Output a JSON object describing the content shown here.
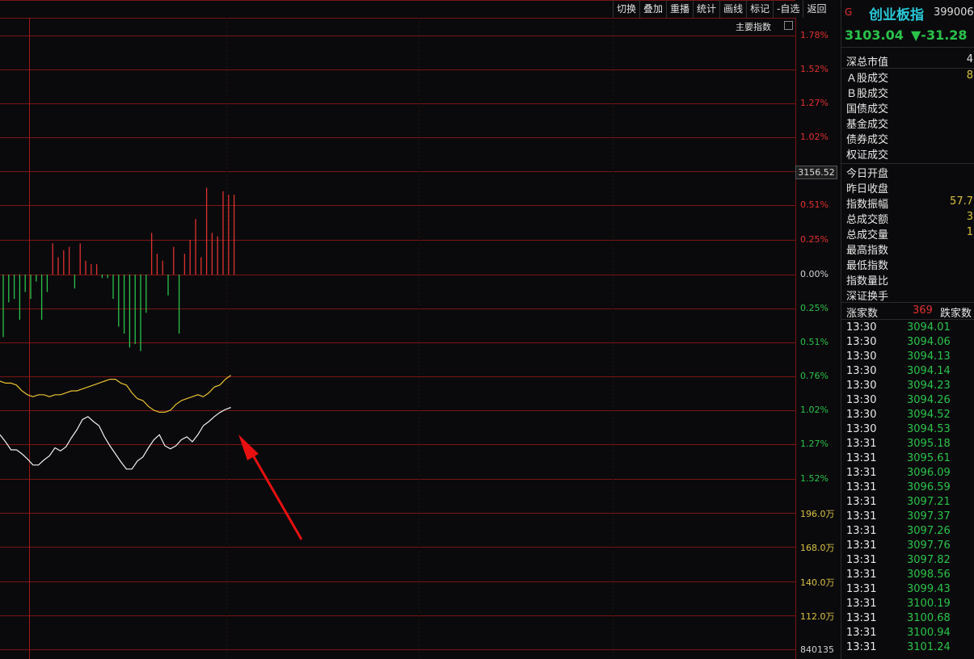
{
  "toolbar": {
    "buttons": [
      "切换",
      "叠加",
      "重播",
      "统计",
      "画线",
      "标记",
      "-自选",
      "返回"
    ]
  },
  "main_index_label": "主要指数",
  "price_tag": "3156.52",
  "right_axis": {
    "upper": [
      "1.78%",
      "1.52%",
      "1.27%",
      "1.02%",
      "0.51%",
      "0.25%",
      "0.00%",
      "0.25%",
      "0.51%",
      "0.76%",
      "1.02%",
      "1.27%",
      "1.52%"
    ],
    "volume": [
      "196.0万",
      "168.0万",
      "140.0万",
      "112.0万"
    ],
    "bottom_value": "840135"
  },
  "colors": {
    "up": "#e03030",
    "down": "#2ac24a",
    "avg_line": "#e8c030",
    "price_line": "#f0f0f0",
    "grid": "#7a1515",
    "arrow": "#e81010",
    "name": "#28c8d8"
  },
  "chart_data": {
    "type": "line",
    "bars": [
      -18,
      -8,
      -7,
      -13,
      -5,
      -7,
      -2,
      -13,
      -5,
      9,
      5,
      7,
      8,
      -4,
      9,
      4,
      3,
      3,
      -1,
      -1,
      -7,
      -15,
      -17,
      -21,
      -20,
      -22,
      -11,
      12,
      6,
      4,
      -6,
      8,
      -17,
      6,
      10,
      16,
      5,
      25,
      12,
      11,
      24,
      23,
      23
    ],
    "avg_line": [
      0.95,
      0.94,
      0.94,
      0.93,
      0.9,
      0.88,
      0.87,
      0.88,
      0.88,
      0.87,
      0.88,
      0.88,
      0.89,
      0.9,
      0.9,
      0.91,
      0.92,
      0.93,
      0.94,
      0.95,
      0.96,
      0.96,
      0.94,
      0.93,
      0.89,
      0.86,
      0.85,
      0.82,
      0.8,
      0.79,
      0.79,
      0.8,
      0.83,
      0.85,
      0.86,
      0.87,
      0.88,
      0.87,
      0.89,
      0.92,
      0.93,
      0.96,
      0.98
    ],
    "price_line": [
      0.75,
      0.68,
      0.6,
      0.6,
      0.56,
      0.51,
      0.45,
      0.45,
      0.5,
      0.54,
      0.62,
      0.59,
      0.63,
      0.72,
      0.8,
      0.9,
      0.93,
      0.88,
      0.84,
      0.73,
      0.64,
      0.56,
      0.48,
      0.41,
      0.41,
      0.49,
      0.53,
      0.62,
      0.7,
      0.75,
      0.64,
      0.61,
      0.64,
      0.7,
      0.73,
      0.68,
      0.75,
      0.84,
      0.88,
      0.93,
      0.97,
      1.0,
      1.02
    ]
  },
  "sidebar": {
    "g": "G",
    "name": "创业板指",
    "code": "399006",
    "last": "3103.04",
    "change": "▼-31.28",
    "market_value_label": "深总市值",
    "market_value": "4",
    "turnover_rows": [
      {
        "label": "Ａ股成交",
        "value": "8"
      },
      {
        "label": "Ｂ股成交",
        "value": ""
      },
      {
        "label": "国债成交",
        "value": ""
      },
      {
        "label": "基金成交",
        "value": ""
      },
      {
        "label": "债券成交",
        "value": ""
      },
      {
        "label": "权证成交",
        "value": ""
      }
    ],
    "stat_rows": [
      {
        "label": "今日开盘",
        "value": ""
      },
      {
        "label": "昨日收盘",
        "value": ""
      },
      {
        "label": "指数振幅",
        "value": "57.7"
      },
      {
        "label": "总成交额",
        "value": "3"
      },
      {
        "label": "总成交量",
        "value": "1"
      },
      {
        "label": "最高指数",
        "value": ""
      },
      {
        "label": "最低指数",
        "value": ""
      },
      {
        "label": "指数量比",
        "value": ""
      },
      {
        "label": "深证换手",
        "value": ""
      }
    ],
    "up_label": "涨家数",
    "up_count": "369",
    "down_label": "跌家数",
    "ticks": [
      {
        "time": "13:30",
        "price": "3094.01"
      },
      {
        "time": "13:30",
        "price": "3094.06"
      },
      {
        "time": "13:30",
        "price": "3094.13"
      },
      {
        "time": "13:30",
        "price": "3094.14"
      },
      {
        "time": "13:30",
        "price": "3094.23"
      },
      {
        "time": "13:30",
        "price": "3094.26"
      },
      {
        "time": "13:30",
        "price": "3094.52"
      },
      {
        "time": "13:30",
        "price": "3094.53"
      },
      {
        "time": "13:31",
        "price": "3095.18"
      },
      {
        "time": "13:31",
        "price": "3095.61"
      },
      {
        "time": "13:31",
        "price": "3096.09"
      },
      {
        "time": "13:31",
        "price": "3096.59"
      },
      {
        "time": "13:31",
        "price": "3097.21"
      },
      {
        "time": "13:31",
        "price": "3097.37"
      },
      {
        "time": "13:31",
        "price": "3097.26"
      },
      {
        "time": "13:31",
        "price": "3097.76"
      },
      {
        "time": "13:31",
        "price": "3097.82"
      },
      {
        "time": "13:31",
        "price": "3098.56"
      },
      {
        "time": "13:31",
        "price": "3099.43"
      },
      {
        "time": "13:31",
        "price": "3100.19"
      },
      {
        "time": "13:31",
        "price": "3100.68"
      },
      {
        "time": "13:31",
        "price": "3100.94"
      },
      {
        "time": "13:31",
        "price": "3101.24"
      }
    ]
  }
}
